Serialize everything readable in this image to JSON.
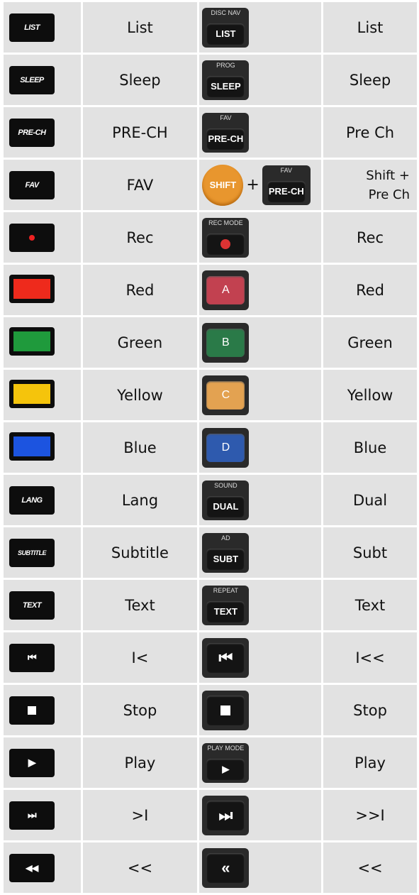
{
  "rows": [
    {
      "left_key": "LIST",
      "left_label": "List",
      "right_cap": "DISC NAV",
      "right_key": "LIST",
      "right_label": "List"
    },
    {
      "left_key": "SLEEP",
      "left_label": "Sleep",
      "right_cap": "PROG",
      "right_key": "SLEEP",
      "right_label": "Sleep"
    },
    {
      "left_key": "PRE-CH",
      "left_label": "PRE-CH",
      "right_cap": "FAV",
      "right_key": "PRE-CH",
      "right_label": "Pre Ch"
    },
    {
      "left_key": "FAV",
      "left_label": "FAV",
      "right_shift": "SHIFT",
      "right_plus": "+",
      "right_cap": "FAV",
      "right_key": "PRE-CH",
      "right_label_1": "Shift +",
      "right_label_2": "Pre Ch"
    },
    {
      "left_key": "",
      "left_label": "Rec",
      "right_cap": "REC MODE",
      "right_key": "",
      "right_label": "Rec"
    },
    {
      "left_key": "",
      "left_label": "Red",
      "right_cap": "",
      "right_key": "A",
      "right_label": "Red"
    },
    {
      "left_key": "",
      "left_label": "Green",
      "right_cap": "",
      "right_key": "B",
      "right_label": "Green"
    },
    {
      "left_key": "",
      "left_label": "Yellow",
      "right_cap": "",
      "right_key": "C",
      "right_label": "Yellow"
    },
    {
      "left_key": "",
      "left_label": "Blue",
      "right_cap": "",
      "right_key": "D",
      "right_label": "Blue"
    },
    {
      "left_key": "LANG",
      "left_label": "Lang",
      "right_cap": "SOUND",
      "right_key": "DUAL",
      "right_label": "Dual"
    },
    {
      "left_key": "SUBTITLE",
      "left_label": "Subtitle",
      "right_cap": "AD",
      "right_key": "SUBT",
      "right_label": "Subt"
    },
    {
      "left_key": "TEXT",
      "left_label": "Text",
      "right_cap": "REPEAT",
      "right_key": "TEXT",
      "right_label": "Text"
    },
    {
      "left_key": "⏮",
      "left_label": "I<",
      "right_cap": "",
      "right_key": "⏮",
      "right_label": "I<<"
    },
    {
      "left_key": "",
      "left_label": "Stop",
      "right_cap": "",
      "right_key": "",
      "right_label": "Stop"
    },
    {
      "left_key": "▶",
      "left_label": "Play",
      "right_cap": "PLAY MODE",
      "right_key": "▶",
      "right_label": "Play"
    },
    {
      "left_key": "⏭",
      "left_label": ">I",
      "right_cap": "",
      "right_key": "⏭",
      "right_label": ">>I"
    },
    {
      "left_key": "◀◀",
      "left_label": "<<",
      "right_cap": "",
      "right_key": "«",
      "right_label": "<<"
    }
  ],
  "colors": {
    "red": "#ee2a1c",
    "green": "#1f9a3c",
    "yellow": "#f5c40c",
    "blue": "#1c54e0",
    "r_red": "#c24150",
    "r_green": "#2a7a48",
    "r_yellow": "#e3a251",
    "r_blue": "#2e5aae",
    "shift": "#e8962e"
  }
}
